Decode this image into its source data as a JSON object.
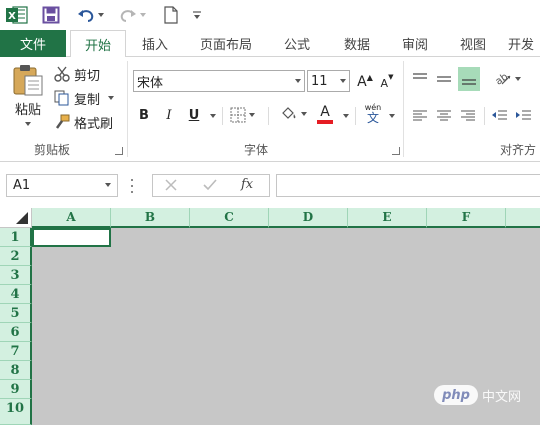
{
  "qat": {
    "excel_logo": "X",
    "icons": [
      "excel-icon",
      "save-icon",
      "undo-icon",
      "redo-icon",
      "new-file-icon",
      "customize-qat-icon"
    ]
  },
  "tabs": {
    "file": "文件",
    "items": [
      "开始",
      "插入",
      "页面布局",
      "公式",
      "数据",
      "审阅",
      "视图",
      "开发"
    ],
    "active": "开始"
  },
  "ribbon": {
    "clipboard": {
      "paste": "粘贴",
      "cut": "剪切",
      "copy": "复制",
      "format_painter": "格式刷",
      "label": "剪贴板"
    },
    "font": {
      "font_name": "宋体",
      "font_size": "11",
      "grow": "A",
      "shrink": "A",
      "bold": "B",
      "italic": "I",
      "underline": "U",
      "font_color_letter": "A",
      "phonetic_top": "wén",
      "phonetic_bottom": "文",
      "label": "字体"
    },
    "alignment": {
      "label": "对齐方"
    }
  },
  "formula_bar": {
    "name_box": "A1",
    "fx": "fx",
    "value": ""
  },
  "grid": {
    "columns": [
      "A",
      "B",
      "C",
      "D",
      "E",
      "F"
    ],
    "rows": [
      "1",
      "2",
      "3",
      "4",
      "5",
      "6",
      "7",
      "8",
      "9",
      "10"
    ],
    "selected_cell": "A1"
  },
  "watermark": {
    "badge": "php",
    "text": "中文网"
  },
  "colors": {
    "excel_green": "#217346",
    "header_fill": "#d3f0e0",
    "grid_fill": "#c7c7c7",
    "font_color_bar": "#e51c23"
  }
}
